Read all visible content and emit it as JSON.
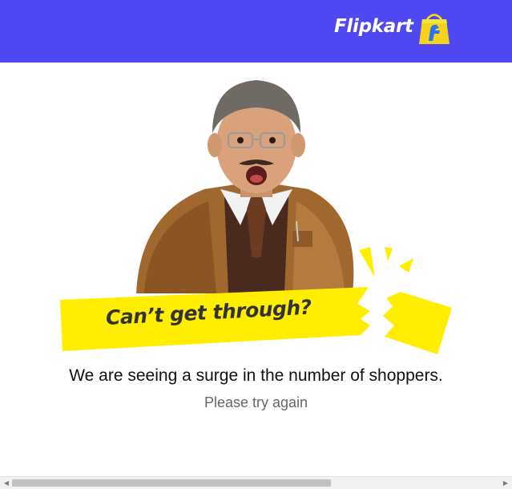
{
  "header": {
    "brand": "Flipkart",
    "background": "#4f47f2",
    "logo_icon": "flipkart-shopping-bag-icon"
  },
  "banner": {
    "headline": "Can’t get through?",
    "color": "#ffee00"
  },
  "main": {
    "message": "We are seeing a surge in the number of shoppers.",
    "subtext": "Please try again"
  },
  "scrollbar": {
    "left_arrow": "◀",
    "right_arrow": "▶"
  }
}
